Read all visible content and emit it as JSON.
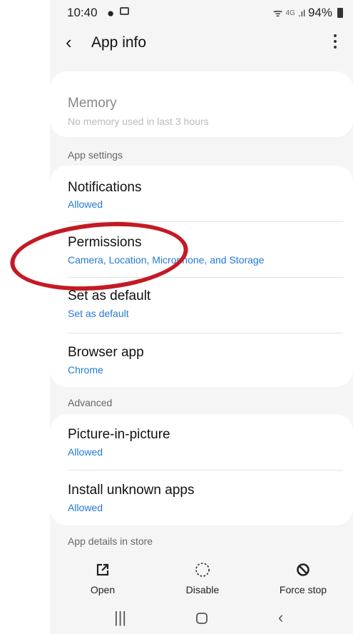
{
  "status_bar": {
    "time": "10:40",
    "network": "4G",
    "battery": "94%"
  },
  "header": {
    "title": "App info"
  },
  "memory": {
    "title": "Memory",
    "subtitle": "No memory used in last 3 hours"
  },
  "sections": {
    "app_settings": "App settings",
    "advanced": "Advanced",
    "store": "App details in store"
  },
  "app_settings": [
    {
      "label": "Notifications",
      "value": "Allowed"
    },
    {
      "label": "Permissions",
      "value": "Camera, Location, Microphone, and Storage"
    },
    {
      "label": "Set as default",
      "value": "Set as default"
    },
    {
      "label": "Browser app",
      "value": "Chrome"
    }
  ],
  "advanced": [
    {
      "label": "Picture-in-picture",
      "value": "Allowed"
    },
    {
      "label": "Install unknown apps",
      "value": "Allowed"
    }
  ],
  "actions": {
    "open": "Open",
    "disable": "Disable",
    "force_stop": "Force stop"
  },
  "colors": {
    "link": "#2479d6",
    "annotation": "#c41a23",
    "background": "#f5f5f5"
  }
}
